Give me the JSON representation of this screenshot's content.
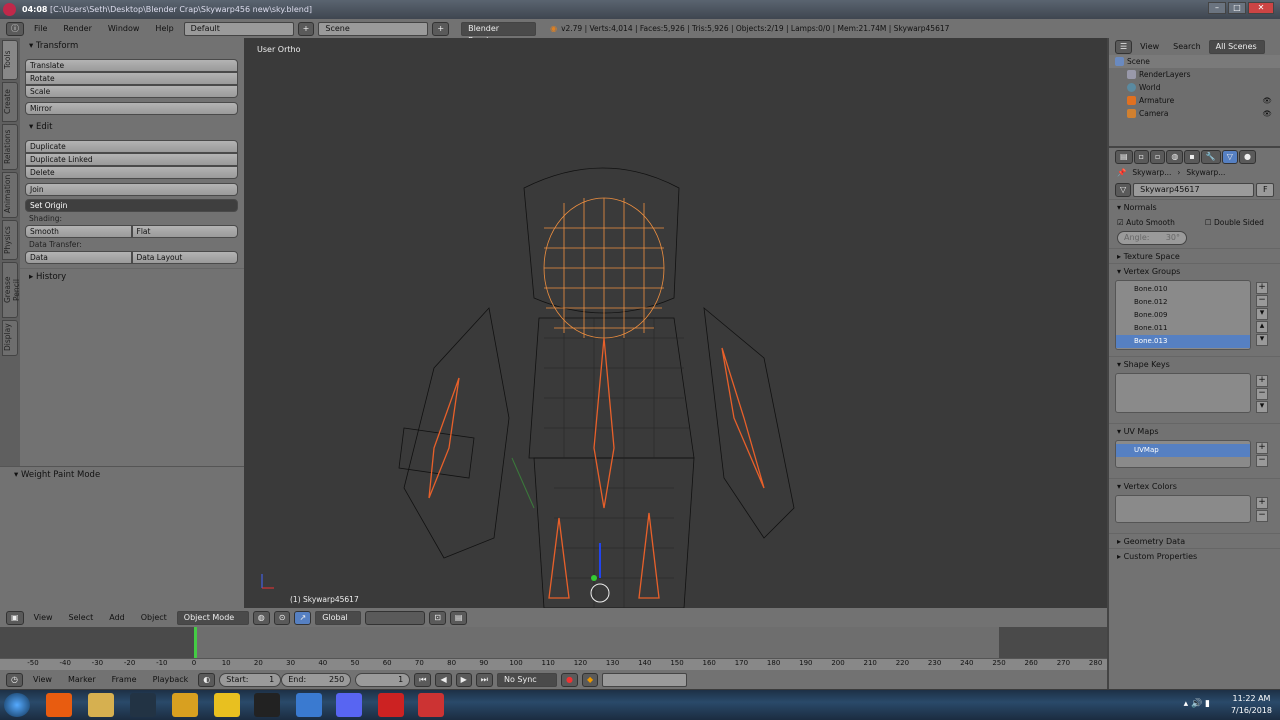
{
  "titlebar": {
    "time": "04:08",
    "path": "[C:\\Users\\Seth\\Desktop\\Blender Crap\\Skywarp456 new\\sky.blend]"
  },
  "info": {
    "menus": [
      "File",
      "Render",
      "Window",
      "Help"
    ],
    "layout": "Default",
    "scene": "Scene",
    "engine": "Blender Render",
    "stats": "v2.79 | Verts:4,014 | Faces:5,926 | Tris:5,926 | Objects:2/19 | Lamps:0/0 | Mem:21.74M | Skywarp45617"
  },
  "tool_tabs": [
    "Tools",
    "Create",
    "Relations",
    "Animation",
    "Physics",
    "Grease Pencil",
    "Display"
  ],
  "tools": {
    "transform": "Transform",
    "translate": "Translate",
    "rotate": "Rotate",
    "scale": "Scale",
    "mirror": "Mirror",
    "edit": "Edit",
    "duplicate": "Duplicate",
    "duplicate_linked": "Duplicate Linked",
    "delete": "Delete",
    "join": "Join",
    "set_origin": "Set Origin",
    "shading": "Shading:",
    "smooth": "Smooth",
    "flat": "Flat",
    "data_transfer": "Data Transfer:",
    "data": "Data",
    "data_layout": "Data Layout",
    "history": "History"
  },
  "operator_panel": "Weight Paint Mode",
  "viewport": {
    "label": "User Ortho",
    "object_label": "(1) Skywarp45617"
  },
  "view_header": {
    "menus": [
      "View",
      "Select",
      "Add",
      "Object"
    ],
    "mode": "Object Mode",
    "orientation": "Global"
  },
  "timeline": {
    "ticks": [
      -50,
      -40,
      -30,
      -20,
      -10,
      0,
      10,
      20,
      30,
      40,
      50,
      60,
      70,
      80,
      90,
      100,
      110,
      120,
      130,
      140,
      150,
      160,
      170,
      180,
      190,
      200,
      210,
      220,
      230,
      240,
      250,
      260,
      270,
      280
    ],
    "menus": [
      "View",
      "Marker",
      "Frame",
      "Playback"
    ],
    "start_label": "Start:",
    "start": "1",
    "end_label": "End:",
    "end": "250",
    "current": "1",
    "sync": "No Sync"
  },
  "outliner": {
    "menus": [
      "View",
      "Search"
    ],
    "filter": "All Scenes",
    "items": [
      "Scene",
      "RenderLayers",
      "World",
      "Armature",
      "Camera"
    ]
  },
  "properties": {
    "breadcrumb1": "Skywarp...",
    "breadcrumb2": "Skywarp...",
    "mesh_name": "Skywarp45617",
    "fake_user": "F",
    "normals": "Normals",
    "auto_smooth": "Auto Smooth",
    "double_sided": "Double Sided",
    "angle": "Angle:",
    "angle_value": "30°",
    "texture_space": "Texture Space",
    "vertex_groups": "Vertex Groups",
    "groups": [
      "Bone.010",
      "Bone.012",
      "Bone.009",
      "Bone.011",
      "Bone.013"
    ],
    "shape_keys": "Shape Keys",
    "uv_maps": "UV Maps",
    "uv_items": [
      "UVMap"
    ],
    "vertex_colors": "Vertex Colors",
    "geometry_data": "Geometry Data",
    "custom_properties": "Custom Properties"
  },
  "taskbar": {
    "time": "11:22 AM",
    "date": "7/16/2018"
  },
  "colors": {
    "selection": "#5680c2",
    "wire_selected": "#f08a30",
    "bone": "#e8602a"
  }
}
